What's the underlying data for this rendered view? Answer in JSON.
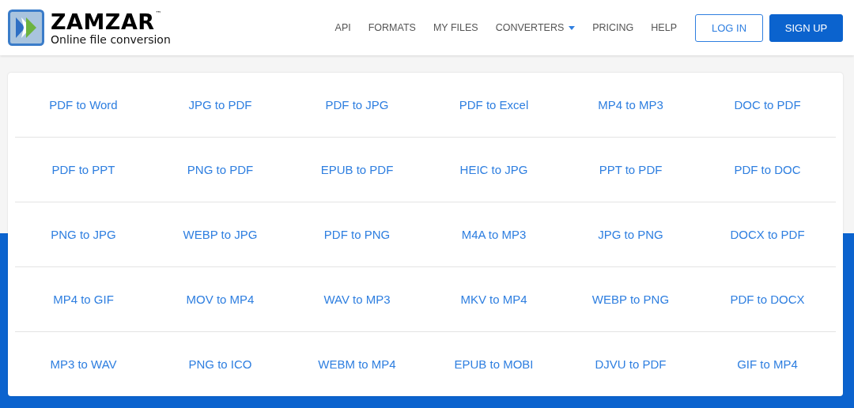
{
  "logo": {
    "name": "ZAMZAR",
    "trademark": "™",
    "tagline": "Online file conversion"
  },
  "nav": [
    {
      "label": "API",
      "kind": "link"
    },
    {
      "label": "FORMATS",
      "kind": "link"
    },
    {
      "label": "MY FILES",
      "kind": "link"
    },
    {
      "label": "CONVERTERS",
      "kind": "dropdown"
    },
    {
      "label": "PRICING",
      "kind": "link"
    },
    {
      "label": "HELP",
      "kind": "link"
    }
  ],
  "buttons": [
    {
      "label": "LOG IN",
      "kind": "outline"
    },
    {
      "label": "SIGN UP",
      "kind": "solid"
    }
  ],
  "conversions": [
    [
      "PDF to Word",
      "JPG to PDF",
      "PDF to JPG",
      "PDF to Excel",
      "MP4 to MP3",
      "DOC to PDF"
    ],
    [
      "PDF to PPT",
      "PNG to PDF",
      "EPUB to PDF",
      "HEIC to JPG",
      "PPT to PDF",
      "PDF to DOC"
    ],
    [
      "PNG to JPG",
      "WEBP to JPG",
      "PDF to PNG",
      "M4A to MP3",
      "JPG to PNG",
      "DOCX to PDF"
    ],
    [
      "MP4 to GIF",
      "MOV to MP4",
      "WAV to MP3",
      "MKV to MP4",
      "WEBP to PNG",
      "PDF to DOCX"
    ],
    [
      "MP3 to WAV",
      "PNG to ICO",
      "WEBM to MP4",
      "EPUB to MOBI",
      "DJVU to PDF",
      "GIF to MP4"
    ]
  ]
}
